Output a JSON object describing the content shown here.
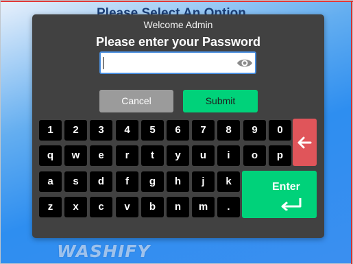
{
  "background": {
    "title": "Please Select An Option",
    "logo_text": "WASHIFY"
  },
  "dialog": {
    "welcome": "Welcome Admin",
    "prompt": "Please enter your Password",
    "password_value": "",
    "password_placeholder": "",
    "cancel_label": "Cancel",
    "submit_label": "Submit",
    "enter_label": "Enter"
  },
  "keyboard": {
    "rows": [
      [
        "1",
        "2",
        "3",
        "4",
        "5",
        "6",
        "7",
        "8",
        "9",
        "0"
      ],
      [
        "q",
        "w",
        "e",
        "r",
        "t",
        "y",
        "u",
        "i",
        "o",
        "p"
      ],
      [
        "a",
        "s",
        "d",
        "f",
        "g",
        "h",
        "j",
        "k",
        "l"
      ],
      [
        "z",
        "x",
        "c",
        "v",
        "b",
        "n",
        "m",
        "."
      ]
    ]
  },
  "colors": {
    "dialog_bg": "#414141",
    "key_bg": "#000000",
    "accent_green": "#00d27a",
    "backspace_red": "#e0555a",
    "cancel_gray": "#9b9b9b",
    "input_border": "#4a8fe0"
  },
  "icons": {
    "toggle_visibility": "eye-icon",
    "backspace": "arrow-left-icon",
    "enter": "return-arrow-icon"
  }
}
